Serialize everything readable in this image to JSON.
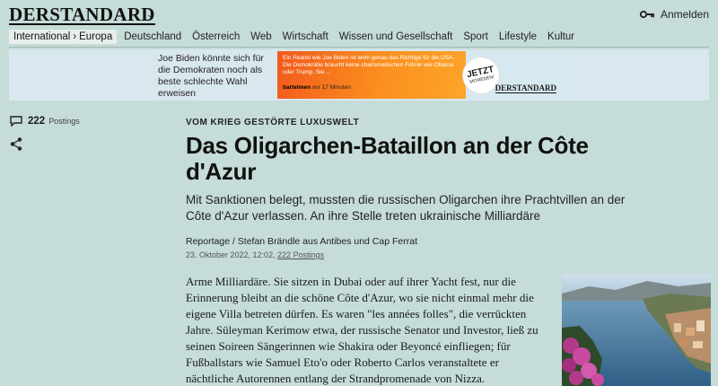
{
  "header": {
    "logo": "DERSTANDARD",
    "login_label": "Anmelden",
    "icons": {
      "logo_menu": "chevron-down-icon",
      "login": "key-icon"
    }
  },
  "nav": {
    "section": "International",
    "subsection": "Europa",
    "items": [
      "Deutschland",
      "Österreich",
      "Web",
      "Wirtschaft",
      "Wissen und Gesellschaft",
      "Sport",
      "Lifestyle",
      "Kultur"
    ]
  },
  "ad": {
    "left_text": "Joe Biden könnte sich für die Demokraten noch als beste schlechte Wahl erweisen",
    "quote": "Ein Realist wie Joe Biden ist wohl genau das Richtige für die USA. Die Demokratie braucht keine charismatischen Führer wie Obama oder Trump. Sie ...",
    "author": "bartelmen",
    "author_suffix": "vor 17 Minuten",
    "bubble_big": "JETZT",
    "bubble_small": "MITREDEN!",
    "logo": "DERSTANDARD",
    "colors": {
      "orange_start": "#f25a1d",
      "orange_end": "#fda52a",
      "banner_bg": "#d9e7ee"
    }
  },
  "sidebar": {
    "postings_count": "222",
    "postings_label": "Postings",
    "icons": {
      "postings": "speech-bubble-icon",
      "share": "share-icon"
    }
  },
  "article": {
    "kicker": "VOM KRIEG GESTÖRTE LUXUSWELT",
    "title": "Das Oligarchen-Bataillon an der Côte d'Azur",
    "lead": "Mit Sanktionen belegt, mussten die russischen Oligarchen ihre Prachtvillen an der Côte d'Azur verlassen. An ihre Stelle treten ukrainische Milliardäre",
    "byline": "Reportage / Stefan Brändle aus Antibes und Cap Ferrat",
    "date": "23. Oktober 2022, 12:02,",
    "postings_link": "222 Postings",
    "body": "Arme Milliardäre. Sie sitzen in Dubai oder auf ihrer Yacht fest, nur die Erinnerung bleibt an die schöne Côte d'Azur, wo sie nicht einmal mehr die eigene Villa betreten dürfen. Es waren \"les années folles\", die verrückten Jahre. Süleyman Kerimow etwa, der russische Senator und Investor, ließ zu seinen Soireen Sängerinnen wie Shakira oder Beyoncé einfliegen; für Fußballstars wie Samuel Eto'o oder Roberto Carlos veranstaltete er nächtliche Autorennen entlang der Strandpromenade von Nizza."
  },
  "theme": {
    "page_bg": "#c5dcd8",
    "text": "#1a1a1a"
  }
}
